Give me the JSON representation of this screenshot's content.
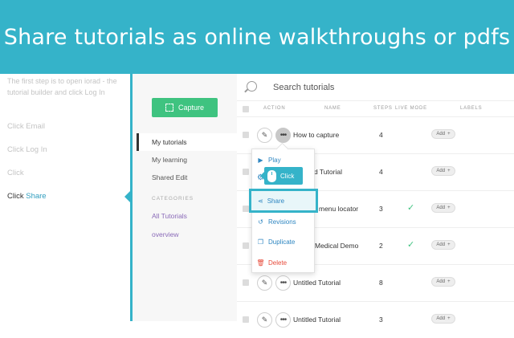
{
  "banner": {
    "title": "Share tutorials as online walkthroughs or pdfs"
  },
  "instructions": {
    "intro": "The first step is to open iorad - the tutorial builder and click Log In",
    "steps": [
      {
        "text": "Click Email",
        "active": false
      },
      {
        "text": "Click Log In",
        "active": false
      },
      {
        "text": "Click",
        "active": false
      }
    ],
    "active_step": {
      "prefix": "Click ",
      "highlight": "Share"
    }
  },
  "sidebar": {
    "capture_label": "Capture",
    "nav": [
      {
        "label": "My tutorials",
        "active": true
      },
      {
        "label": "My learning",
        "active": false
      },
      {
        "label": "Shared Edit",
        "active": false
      }
    ],
    "categories_heading": "CATEGORIES",
    "categories": [
      "All Tutorials",
      "overview"
    ]
  },
  "search": {
    "placeholder": "Search tutorials"
  },
  "table": {
    "headers": {
      "action": "ACTION",
      "name": "NAME",
      "steps": "STEPS",
      "live": "LIVE MODE",
      "labels": "LABELS"
    },
    "add_label": "Add",
    "rows": [
      {
        "name": "How to capture",
        "steps": "4",
        "live": false
      },
      {
        "name": "d Tutorial",
        "steps": "4",
        "live": false
      },
      {
        "name": "menu locator",
        "steps": "3",
        "live": true
      },
      {
        "name": "Medical Demo",
        "steps": "2",
        "live": true
      },
      {
        "name": "Untitled Tutorial",
        "steps": "8",
        "live": false
      },
      {
        "name": "Untitled Tutorial",
        "steps": "3",
        "live": false
      }
    ]
  },
  "menu": {
    "play": "Play",
    "share": "Share",
    "revisions": "Revisions",
    "duplicate": "Duplicate",
    "delete": "Delete"
  },
  "tooltip": {
    "label": "Click"
  },
  "colors": {
    "accent": "#35b3c9",
    "capture_green": "#3fc380",
    "menu_blue": "#2e86c1",
    "delete_red": "#e74c3c",
    "category_purple": "#8a6ab8"
  }
}
